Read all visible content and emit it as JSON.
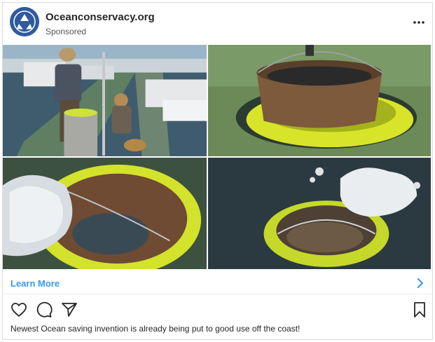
{
  "post": {
    "account_name": "Oceanconservacy.org",
    "sponsored_label": "Sponsored",
    "cta_label": "Learn More",
    "caption": "Newest Ocean saving invention is already being put to good use off the coast!"
  },
  "icons": {
    "avatar": "recycle-logo-icon",
    "more": "more-horizontal-icon",
    "cta": "chevron-right-icon",
    "like": "heart-icon",
    "comment": "comment-icon",
    "share": "paper-plane-icon",
    "save": "bookmark-icon"
  },
  "colors": {
    "link": "#3897f0",
    "avatar_bg": "#2f5a9e",
    "bin_yellow": "#d7e62c"
  }
}
